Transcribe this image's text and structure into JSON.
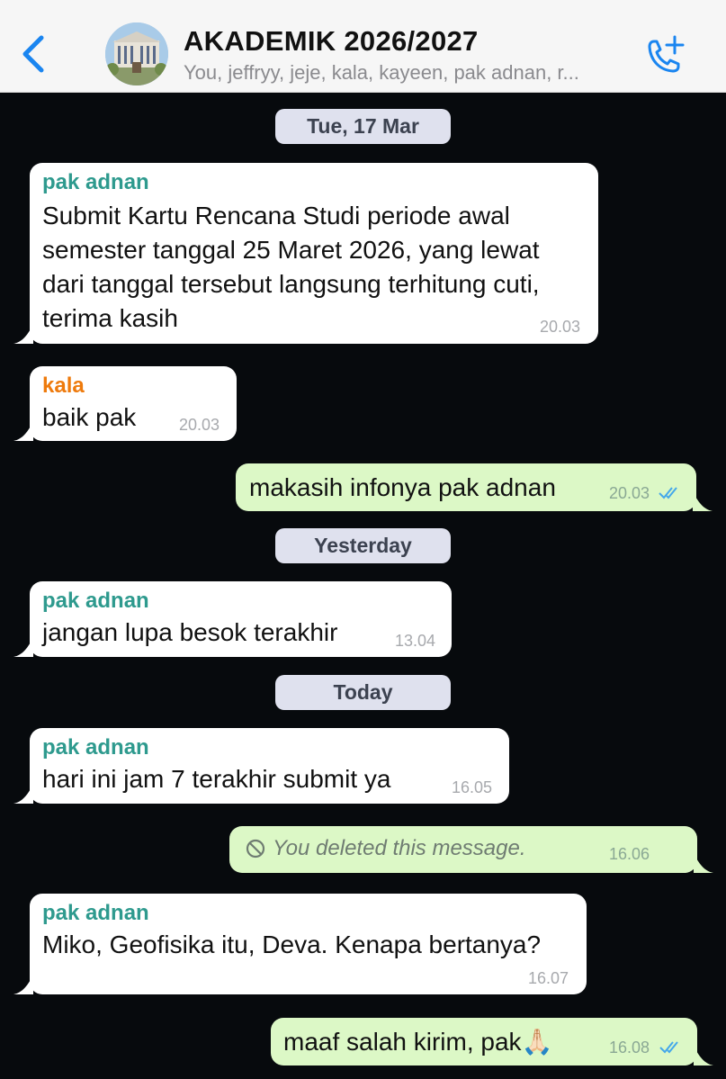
{
  "header": {
    "title": "AKADEMIK 2026/2027",
    "subtitle": "You, jeffryy, jeje, kala, kayeen, pak adnan, r..."
  },
  "colors": {
    "accent": "#1a85f0",
    "chat_bg": "#070a0d",
    "incoming_bubble": "#ffffff",
    "outgoing_bubble": "#dcf8c6",
    "sender_teal": "#2e9a8e",
    "sender_orange": "#ee7a0c"
  },
  "date_separators": [
    "Tue, 17 Mar",
    "Yesterday",
    "Today"
  ],
  "messages": [
    {
      "direction": "in",
      "sender": "pak adnan",
      "lines": [
        "Submit Kartu Rencana Studi periode awal",
        "semester tanggal 25 Maret 2026, yang lewat",
        "dari tanggal tersebut langsung terhitung cuti,",
        "terima kasih"
      ],
      "time": "20.03"
    },
    {
      "direction": "in",
      "sender": "kala",
      "text": "baik pak",
      "time": "20.03"
    },
    {
      "direction": "out",
      "text": "makasih infonya pak adnan",
      "time": "20.03",
      "read": true
    },
    {
      "direction": "in",
      "sender": "pak adnan",
      "text": "jangan lupa besok terakhir",
      "time": "13.04"
    },
    {
      "direction": "in",
      "sender": "pak adnan",
      "text": "hari ini jam 7 terakhir submit ya",
      "time": "16.05"
    },
    {
      "direction": "out",
      "deleted": true,
      "text": "You deleted this message.",
      "time": "16.06"
    },
    {
      "direction": "in",
      "sender": "pak adnan",
      "text": "Miko, Geofisika itu, Deva. Kenapa bertanya?",
      "time": "16.07"
    },
    {
      "direction": "out",
      "text": "maaf salah kirim, pak🙏🏻",
      "time": "16.08",
      "read": true
    }
  ],
  "icons": [
    "chevron-left-icon",
    "group-avatar",
    "add-call-icon",
    "double-check-icon",
    "deleted-icon"
  ]
}
